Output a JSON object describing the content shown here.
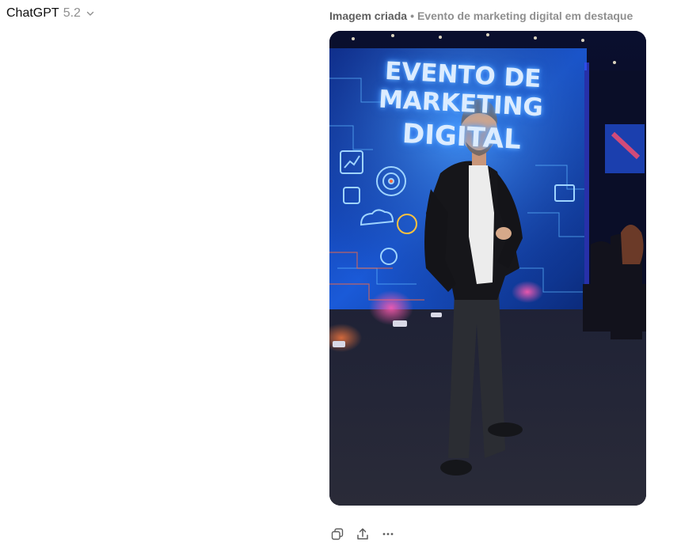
{
  "header": {
    "model_name": "ChatGPT",
    "model_version": "5.2",
    "chevron_icon": "chevron-down-icon"
  },
  "message": {
    "caption_label": "Imagem criada",
    "caption_separator": "•",
    "caption_description": "Evento de marketing digital em destaque",
    "image": {
      "screen_text_lines": [
        "EVENTO DE",
        "MARKETING",
        "DIGITAL"
      ]
    }
  },
  "actions": [
    {
      "name": "copy-button",
      "icon": "copy-icon"
    },
    {
      "name": "share-button",
      "icon": "share-icon"
    },
    {
      "name": "more-options-button",
      "icon": "more-horizontal-icon"
    }
  ],
  "colors": {
    "primary_text": "#0d0d0d",
    "secondary_text": "#8f8f8f",
    "caption_label": "#5d5d5d",
    "screen_glow": "#2f7bff",
    "neon_accent": "#ff4fa8"
  }
}
